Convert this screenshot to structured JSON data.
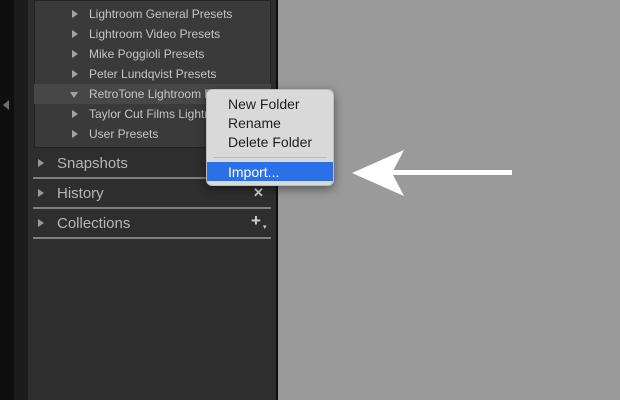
{
  "presets": [
    {
      "label": "Lightroom General Presets",
      "expanded": false
    },
    {
      "label": "Lightroom Video Presets",
      "expanded": false
    },
    {
      "label": "Mike Poggioli Presets",
      "expanded": false
    },
    {
      "label": "Peter Lundqvist Presets",
      "expanded": false
    },
    {
      "label": "RetroTone Lightroom F",
      "expanded": true,
      "selected": true
    },
    {
      "label": "Taylor Cut Films Lightro",
      "expanded": false
    },
    {
      "label": "User Presets",
      "expanded": false
    }
  ],
  "sections": {
    "snapshots": "Snapshots",
    "history": "History",
    "history_clear": "✕",
    "collections": "Collections",
    "collections_add": "+",
    "collections_add_caret": "▾"
  },
  "context_menu": {
    "new_folder": "New Folder",
    "rename": "Rename",
    "delete_folder": "Delete Folder",
    "import": "Import..."
  },
  "colors": {
    "menu_highlight": "#2c70e8",
    "panel_bg": "#2e2e2e",
    "canvas_bg": "#9a9a9a"
  },
  "icons": {
    "collapse_panel": "chevron-left-icon",
    "pointer": "arrow-left-icon"
  }
}
